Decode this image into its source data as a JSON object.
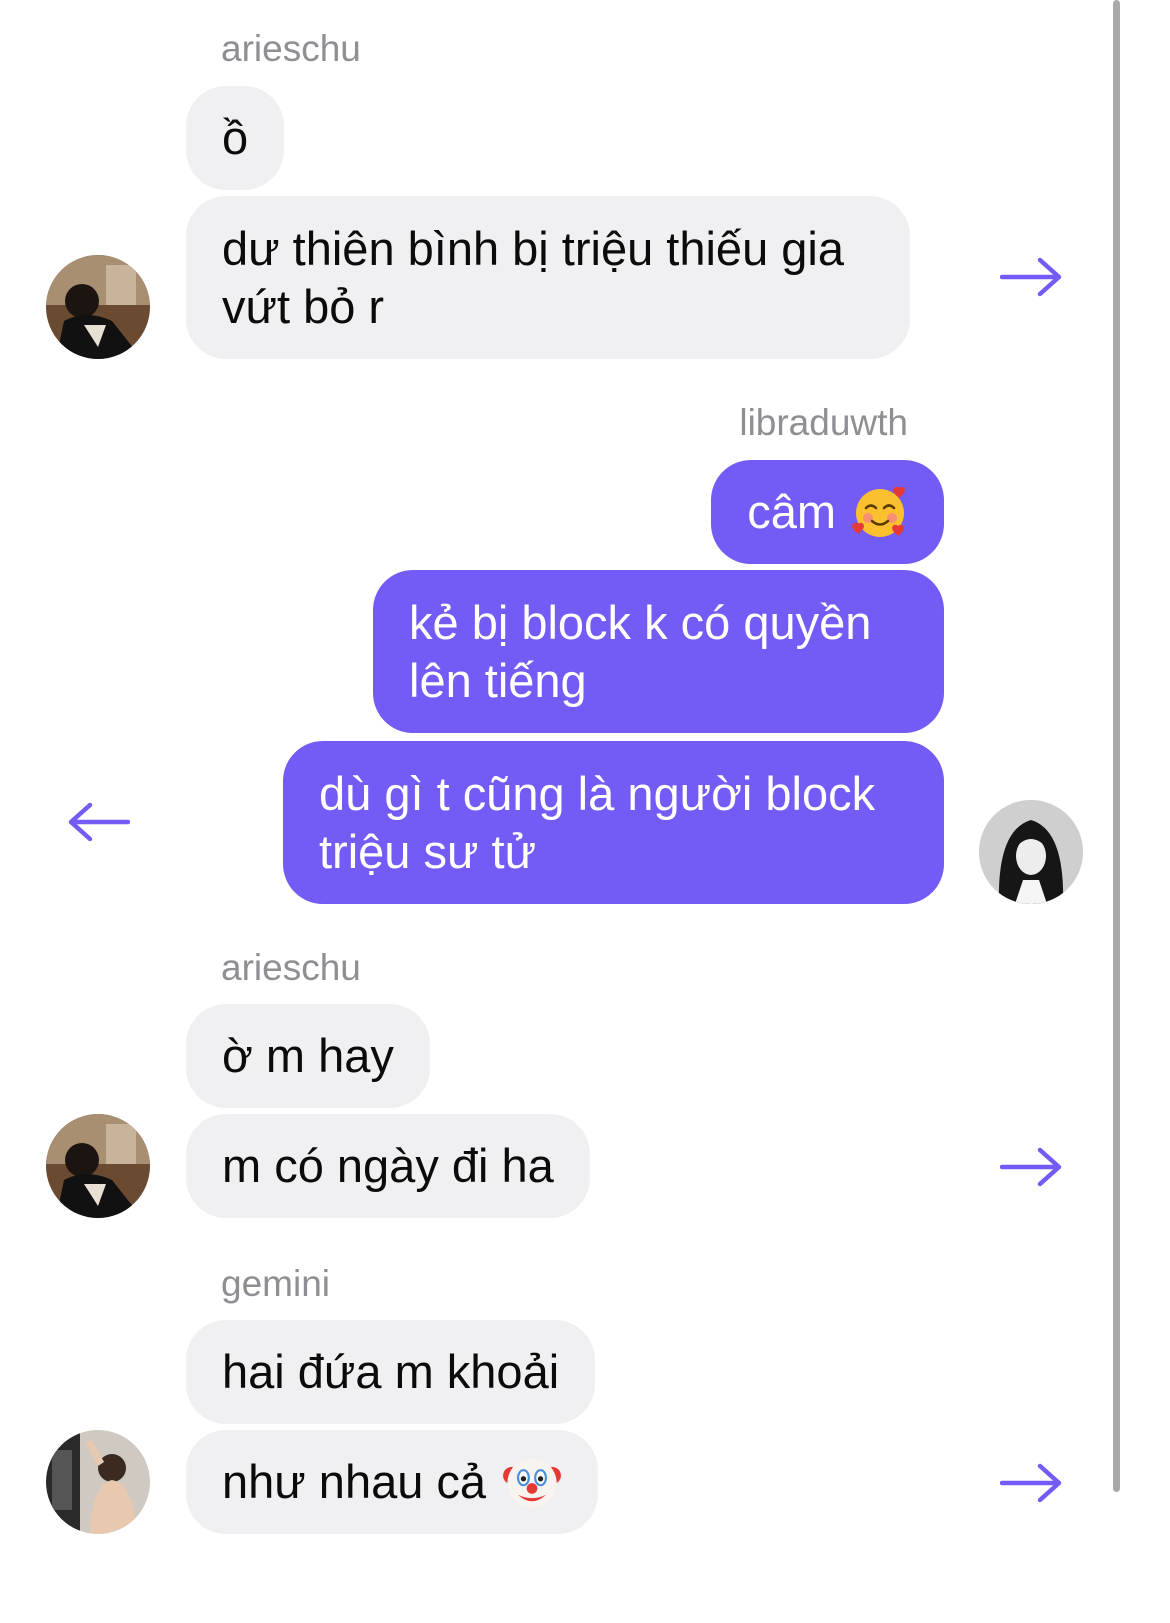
{
  "accent_color": "#735bf5",
  "incoming_bubble_color": "#f0f0f3",
  "groups": [
    {
      "sender": "arieschu",
      "messages": [
        "ồ",
        "dư thiên bình bị triệu thiếu gia\nvứt bỏ r"
      ],
      "action_icon": "forward-arrow-icon"
    },
    {
      "sender": "libraduwth",
      "messages": [
        {
          "text": "câm",
          "emoji": "smiling-face-with-hearts"
        },
        "kẻ bị block k có quyền\nlên tiếng",
        "dù gì t cũng là người block\ntriệu sư tử"
      ],
      "action_icon": "reply-arrow-icon"
    },
    {
      "sender": "arieschu",
      "messages": [
        "ờ m hay",
        "m có ngày đi ha"
      ],
      "action_icon": "forward-arrow-icon"
    },
    {
      "sender": "gemini",
      "messages": [
        "hai đứa m khoải",
        {
          "text": "như nhau cả",
          "emoji": "clown-face"
        }
      ],
      "action_icon": "forward-arrow-icon"
    }
  ]
}
